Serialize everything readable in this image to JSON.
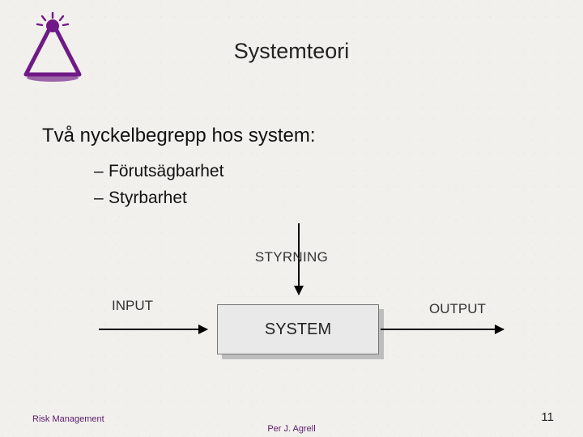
{
  "title": "Systemteori",
  "intro": "Två nyckelbegrepp hos system:",
  "bullets": [
    "Förutsägbarhet",
    "Styrbarhet"
  ],
  "diagram": {
    "control_label": "STYRNING",
    "input_label": "INPUT",
    "output_label": "OUTPUT",
    "box_label": "SYSTEM"
  },
  "footer": {
    "left": "Risk Management",
    "center": "Per J. Agrell",
    "page": "11"
  },
  "colors": {
    "accent": "#6f1a86"
  }
}
